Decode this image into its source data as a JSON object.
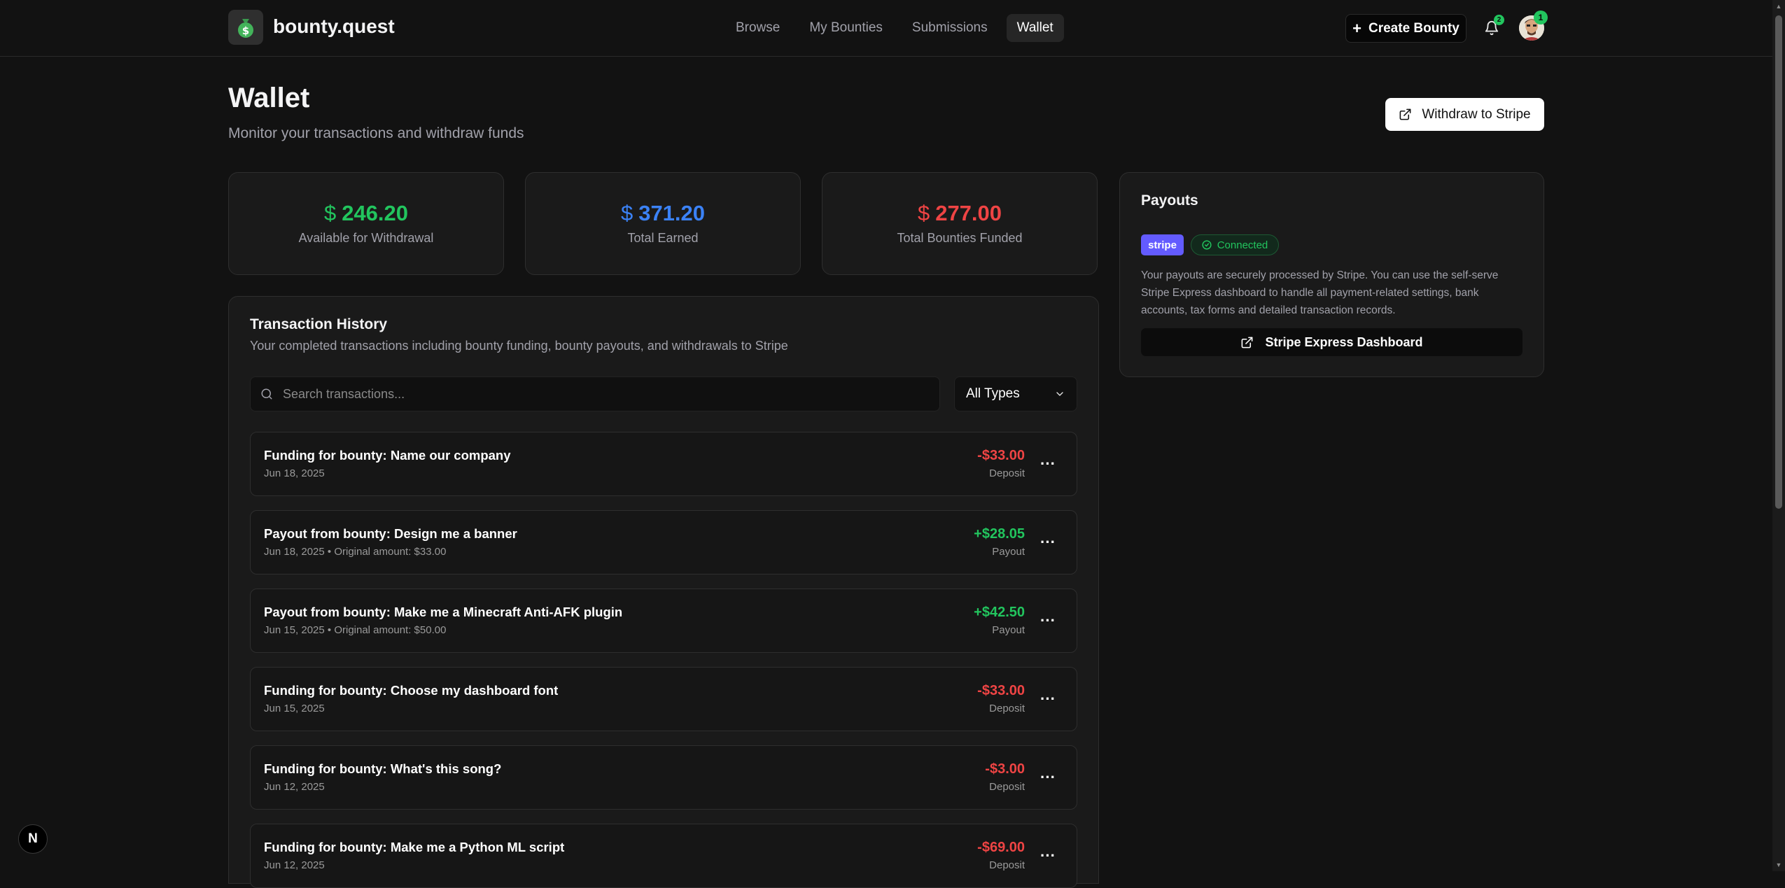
{
  "header": {
    "brand": "bounty.quest",
    "nav": [
      {
        "label": "Browse",
        "active": false
      },
      {
        "label": "My Bounties",
        "active": false
      },
      {
        "label": "Submissions",
        "active": false
      },
      {
        "label": "Wallet",
        "active": true
      }
    ],
    "create_label": "Create Bounty",
    "notification_count": "2",
    "avatar_badge": "1"
  },
  "page": {
    "title": "Wallet",
    "subtitle": "Monitor your transactions and withdraw funds",
    "withdraw_label": "Withdraw to Stripe"
  },
  "stats": [
    {
      "amount": "246.20",
      "label": "Available for Withdrawal",
      "color": "#22c55e"
    },
    {
      "amount": "371.20",
      "label": "Total Earned",
      "color": "#3b82f6"
    },
    {
      "amount": "277.00",
      "label": "Total Bounties Funded",
      "color": "#ef4444"
    }
  ],
  "payouts": {
    "title": "Payouts",
    "stripe_badge": "stripe",
    "status": "Connected",
    "description": "Your payouts are securely processed by Stripe. You can use the self-serve Stripe Express dashboard to handle all payment-related settings, bank accounts, tax forms and detailed transaction records.",
    "dashboard_label": "Stripe Express Dashboard"
  },
  "transactions": {
    "title": "Transaction History",
    "subtitle": "Your completed transactions including bounty funding, bounty payouts, and withdrawals to Stripe",
    "search_placeholder": "Search transactions...",
    "filter_value": "All Types",
    "items": [
      {
        "title": "Funding for bounty: Name our company",
        "meta": "Jun 18, 2025",
        "amount": "-$33.00",
        "type": "Deposit",
        "sign": "neg"
      },
      {
        "title": "Payout from bounty: Design me a banner",
        "meta": "Jun 18, 2025 • Original amount: $33.00",
        "amount": "+$28.05",
        "type": "Payout",
        "sign": "pos"
      },
      {
        "title": "Payout from bounty: Make me a Minecraft Anti-AFK plugin",
        "meta": "Jun 15, 2025 • Original amount: $50.00",
        "amount": "+$42.50",
        "type": "Payout",
        "sign": "pos"
      },
      {
        "title": "Funding for bounty: Choose my dashboard font",
        "meta": "Jun 15, 2025",
        "amount": "-$33.00",
        "type": "Deposit",
        "sign": "neg"
      },
      {
        "title": "Funding for bounty: What's this song?",
        "meta": "Jun 12, 2025",
        "amount": "-$3.00",
        "type": "Deposit",
        "sign": "neg"
      },
      {
        "title": "Funding for bounty: Make me a Python ML script",
        "meta": "Jun 12, 2025",
        "amount": "-$69.00",
        "type": "Deposit",
        "sign": "neg"
      }
    ]
  },
  "dev_badge": "N"
}
